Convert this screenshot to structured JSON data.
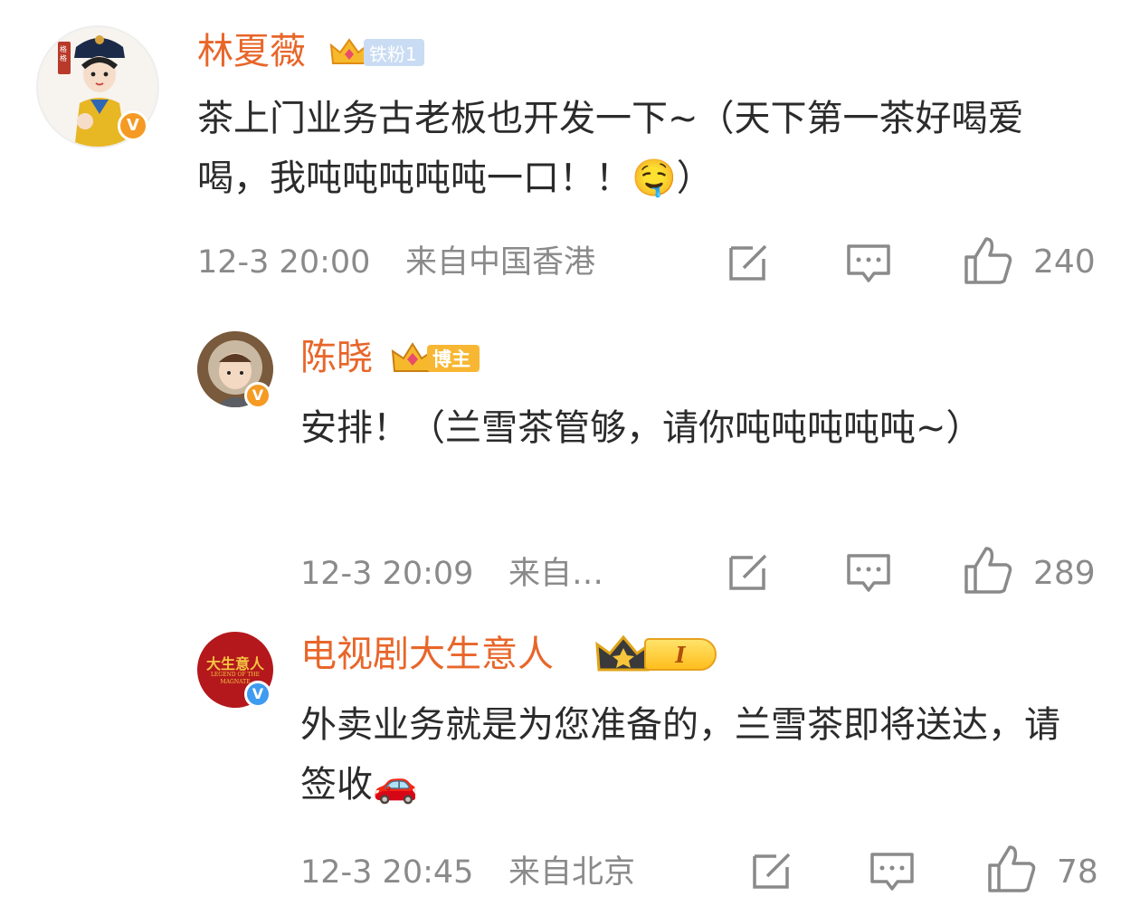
{
  "comments": [
    {
      "username": "林夏薇",
      "badge_label": "铁粉1",
      "verified_badge": "V",
      "avatar_seal": "格格",
      "content": "茶上门业务古老板也开发一下~（天下第一茶好喝爱喝，我吨吨吨吨吨一口！！🤤）",
      "time": "12-3 20:00",
      "source": "来自中国香港",
      "likes": "240"
    },
    {
      "username": "陈晓",
      "badge_label": "博主",
      "verified_badge": "V",
      "content": "安排！（兰雪茶管够，请你吨吨吨吨吨~）",
      "time": "12-3 20:09",
      "source": "来自…",
      "likes": "289"
    },
    {
      "username": "电视剧大生意人",
      "badge_label": "I",
      "verified_badge": "V",
      "avatar_title": "大生意人",
      "avatar_subtitle": "LEGEND OF THE MAGNATE",
      "content": "外卖业务就是为您准备的，兰雪茶即将送达，请签收🚗",
      "time": "12-3 20:45",
      "source": "来自北京",
      "likes": "78"
    }
  ],
  "icons": {
    "share": "share-icon",
    "reply": "comment-icon",
    "like": "thumbs-up-icon"
  },
  "colors": {
    "username": "#e8662a",
    "meta": "#8a8a8a",
    "verified_orange": "#f59a23",
    "verified_blue": "#3f9bf0",
    "fan_badge": "#c9dcf3",
    "host_badge": "#f7b733"
  }
}
